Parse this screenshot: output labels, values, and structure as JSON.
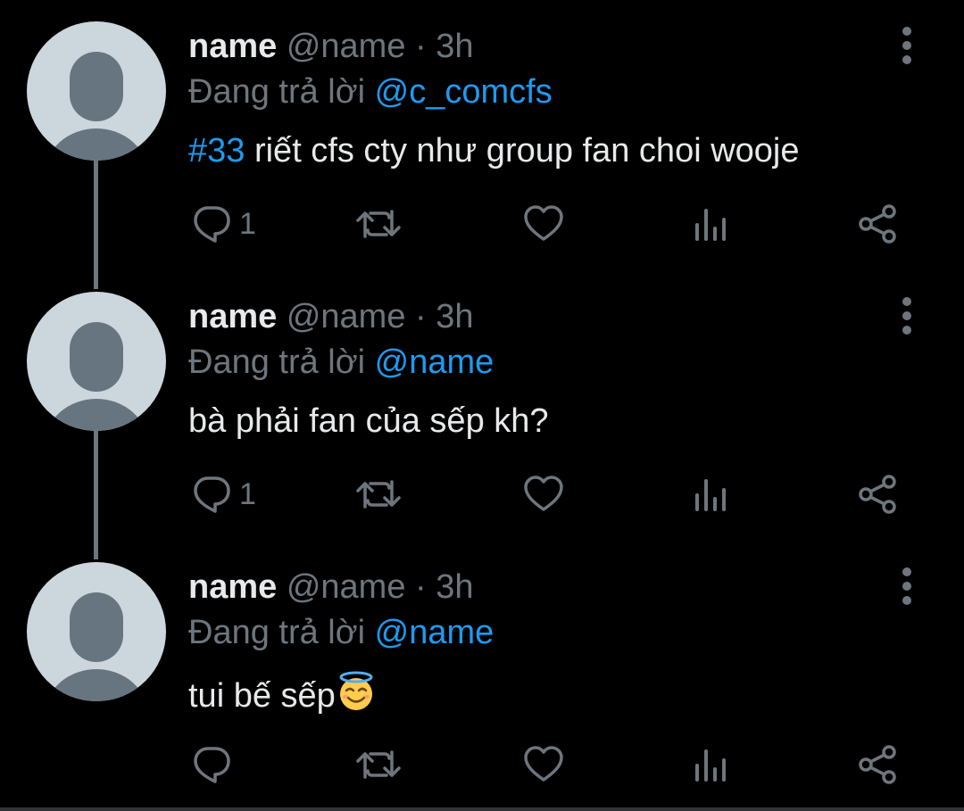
{
  "colors": {
    "background": "#000000",
    "text_primary": "#e7e9ea",
    "text_secondary": "#6e767d",
    "accent": "#1d9bf0",
    "avatar_bg": "#ccd6dd",
    "avatar_fg": "#66757f"
  },
  "tweets": [
    {
      "name": "name",
      "handle": "@name",
      "separator": "·",
      "time": "3h",
      "reply_prefix": "Đang trả lời",
      "reply_to": "@c_comcfs",
      "hashtag": "#33",
      "text": " riết cfs cty như group fan choi wooje",
      "reply_count": "1",
      "icons": [
        "reply-icon",
        "retweet-icon",
        "like-icon",
        "analytics-icon",
        "share-icon",
        "more-icon"
      ]
    },
    {
      "name": "name",
      "handle": "@name",
      "separator": "·",
      "time": "3h",
      "reply_prefix": "Đang trả lời",
      "reply_to": "@name",
      "text": "bà phải fan của sếp kh?",
      "reply_count": "1",
      "icons": [
        "reply-icon",
        "retweet-icon",
        "like-icon",
        "analytics-icon",
        "share-icon",
        "more-icon"
      ]
    },
    {
      "name": "name",
      "handle": "@name",
      "separator": "·",
      "time": "3h",
      "reply_prefix": "Đang trả lời",
      "reply_to": "@name",
      "text": "tui bế sếp",
      "emoji": "smiling-face-with-halo-emoji",
      "reply_count": "",
      "icons": [
        "reply-icon",
        "retweet-icon",
        "like-icon",
        "analytics-icon",
        "share-icon",
        "more-icon"
      ]
    }
  ]
}
